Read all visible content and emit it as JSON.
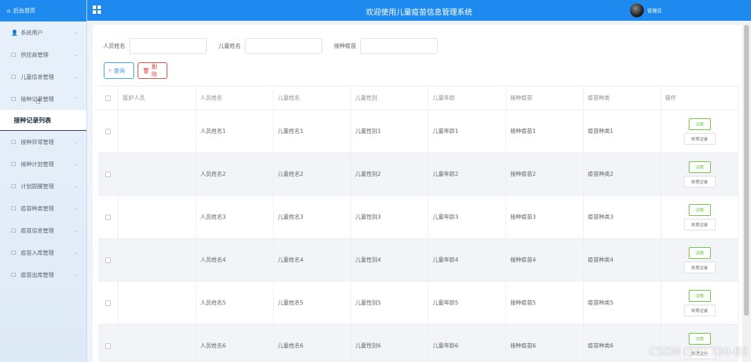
{
  "app": {
    "title": "欢迎使用儿童疫苗信息管理系统",
    "user": "管理员"
  },
  "sidebar": {
    "home": "后台首页",
    "items": [
      {
        "label": "系统用户",
        "icon": "user-icon"
      },
      {
        "label": "供应商管理",
        "icon": "doc-icon"
      },
      {
        "label": "儿童信息管理",
        "icon": "doc-icon"
      },
      {
        "label": "接种记录管理",
        "icon": "doc-icon",
        "expanded": true
      },
      {
        "label": "接种异常管理",
        "icon": "doc-icon"
      },
      {
        "label": "接种计划管理",
        "icon": "doc-icon"
      },
      {
        "label": "计划提醒管理",
        "icon": "doc-icon"
      },
      {
        "label": "疫苗种类管理",
        "icon": "doc-icon"
      },
      {
        "label": "疫苗信息管理",
        "icon": "doc-icon"
      },
      {
        "label": "疫苗入库管理",
        "icon": "doc-icon"
      },
      {
        "label": "疫苗出库管理",
        "icon": "doc-icon"
      }
    ],
    "sub_item": "接种记录列表"
  },
  "search": {
    "fields": [
      {
        "label": "人员姓名",
        "value": ""
      },
      {
        "label": "儿童姓名",
        "value": ""
      },
      {
        "label": "接种疫苗",
        "value": ""
      }
    ],
    "query_label": "查询",
    "delete_label": "删除"
  },
  "table": {
    "headers": [
      "医护人员",
      "人员姓名",
      "儿童姓名",
      "儿童性别",
      "儿童年龄",
      "接种疫苗",
      "疫苗种类",
      "操作"
    ],
    "rows": [
      [
        "",
        "人员姓名1",
        "儿童姓名1",
        "儿童性别1",
        "儿童年龄1",
        "接种疫苗1",
        "疫苗种类1"
      ],
      [
        "",
        "人员姓名2",
        "儿童姓名2",
        "儿童性别2",
        "儿童年龄2",
        "接种疫苗2",
        "疫苗种类2"
      ],
      [
        "",
        "人员姓名3",
        "儿童姓名3",
        "儿童性别3",
        "儿童年龄3",
        "接种疫苗3",
        "疫苗种类3"
      ],
      [
        "",
        "人员姓名4",
        "儿童姓名4",
        "儿童性别4",
        "儿童年龄4",
        "接种疫苗4",
        "疫苗种类4"
      ],
      [
        "",
        "人员姓名5",
        "儿童姓名5",
        "儿童性别5",
        "儿童年龄5",
        "接种疫苗5",
        "疫苗种类5"
      ],
      [
        "",
        "人员姓名6",
        "儿童姓名6",
        "儿童性别6",
        "儿童年龄6",
        "接种疫苗6",
        "疫苗种类6"
      ]
    ],
    "op_detail": "详情",
    "op_abnormal": "异常记录"
  },
  "watermark": "CSDN @81330-BS",
  "colors": {
    "accent": "#1e8af0",
    "danger": "#e64242",
    "success": "#67c23a"
  }
}
